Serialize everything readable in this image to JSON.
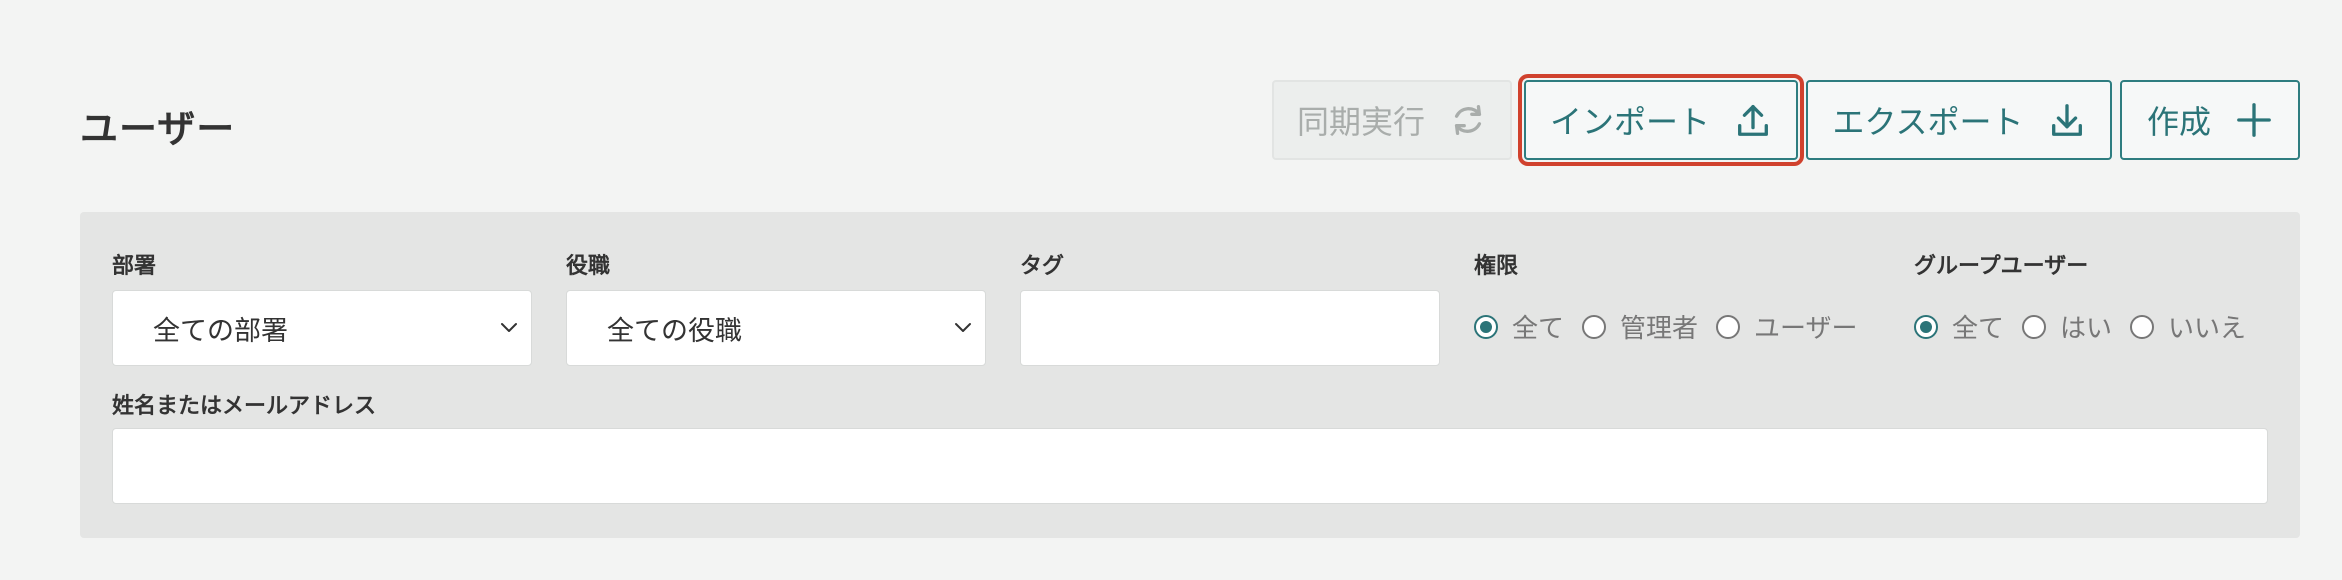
{
  "page": {
    "title": "ユーザー"
  },
  "toolbar": {
    "sync_label": "同期実行",
    "import_label": "インポート",
    "export_label": "エクスポート",
    "create_label": "作成"
  },
  "icons": {
    "sync": "sync-icon",
    "import": "upload-icon",
    "export": "download-icon",
    "create": "plus-icon",
    "select": "chevron-down-icon"
  },
  "colors": {
    "accent": "#2b7478",
    "highlight": "#d0412d",
    "panel": "#e4e5e4",
    "background": "#f3f4f3",
    "disabled_text": "#a9adab"
  },
  "filters": {
    "department": {
      "label": "部署",
      "value": "全ての部署"
    },
    "position": {
      "label": "役職",
      "value": "全ての役職"
    },
    "tag": {
      "label": "タグ",
      "value": ""
    },
    "permission": {
      "label": "権限",
      "options": [
        "全て",
        "管理者",
        "ユーザー"
      ],
      "selected": "全て"
    },
    "group_user": {
      "label": "グループユーザー",
      "options": [
        "全て",
        "はい",
        "いいえ"
      ],
      "selected": "全て"
    },
    "name_email": {
      "label": "姓名またはメールアドレス",
      "value": ""
    }
  }
}
